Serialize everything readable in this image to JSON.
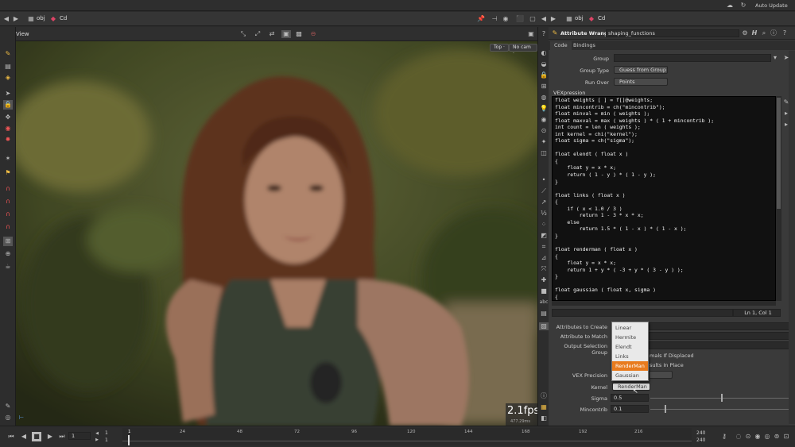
{
  "topbar": {
    "auto_update": "Auto Update"
  },
  "left_path": {
    "level1": "obj",
    "level2": "Cd"
  },
  "right_path": {
    "level1": "obj",
    "level2": "Cd"
  },
  "viewport": {
    "title": "View",
    "camera_top": "Top",
    "camera_none": "No cam",
    "fps": "2.1fps",
    "ms": "477.29ms"
  },
  "node": {
    "type": "Attribute Wrangle",
    "name": "shaping_functions",
    "tabs": [
      "Code",
      "Bindings"
    ]
  },
  "params": {
    "group_label": "Group",
    "group_value": "",
    "group_type_label": "Group Type",
    "group_type_value": "Guess from Group",
    "run_over_label": "Run Over",
    "run_over_value": "Points",
    "vexpression_label": "VEXpression",
    "status": "Ln 1, Col 1",
    "attrs_create_label": "Attributes to Create",
    "attr_match_label": "Attribute to Match",
    "output_sel_label": "Output Selection Group",
    "normals_text": "mals If Displaced",
    "results_text": "sults In Place",
    "vex_precision_label": "VEX Precision",
    "kernel_label": "Kernel",
    "kernel_value": "RenderMan",
    "sigma_label": "Sigma",
    "sigma_value": "0.5",
    "mincontrib_label": "Mincontrib",
    "mincontrib_value": "0.1"
  },
  "code_lines": "float weights [ ] = f[]@weights;\nfloat mincontrib = ch(\"mincontrib\");\nfloat minval = min ( weights );\nfloat maxval = max ( weights ) * ( 1 + mincontrib );\nint count = len ( weights );\nint kernel = chi(\"kernel\");\nfloat sigma = ch(\"sigma\");\n\nfloat elendt ( float x )\n{\n    float y = x * x;\n    return ( 1 - y ) * ( 1 - y );\n}\n\nfloat links ( float x )\n{\n    if ( x < 1.0 / 3 )\n        return 1 - 3 * x * x;\n    else\n        return 1.5 * ( 1 - x ) * ( 1 - x );\n}\n\nfloat renderman ( float x )\n{\n    float y = x * x;\n    return 1 + y * ( -3 + y * ( 3 - y ) );\n}\n\nfloat gaussian ( float x, sigma )\n{",
  "kernel_menu": [
    "Linear",
    "Hermite",
    "Elendt",
    "Links",
    "RenderMan",
    "Gaussian"
  ],
  "kernel_menu_selected": "RenderMan",
  "timeline": {
    "current_frame": "1",
    "start": "1",
    "start2": "1",
    "ticks": [
      "1",
      "24",
      "48",
      "72",
      "96",
      "120",
      "144",
      "168",
      "192",
      "216"
    ],
    "end": "240",
    "end2": "240"
  },
  "colors": {
    "accent": "#e87b1e",
    "code_bg": "#111111"
  }
}
